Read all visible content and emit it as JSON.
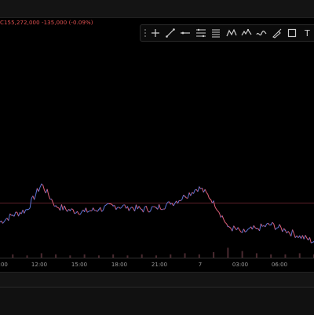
{
  "legend": {
    "symbol": "C",
    "last": "155,272,000",
    "change": "-135,000 (-0.09%)"
  },
  "toolbar": {
    "tools": [
      {
        "name": "crosshair-icon"
      },
      {
        "name": "trend-line-icon"
      },
      {
        "name": "horizontal-ray-icon"
      },
      {
        "name": "parallel-channel-icon"
      },
      {
        "name": "fib-retracement-icon"
      },
      {
        "name": "xabcd-pattern-icon"
      },
      {
        "name": "elliott-wave-icon"
      },
      {
        "name": "path-icon"
      },
      {
        "name": "brush-icon"
      },
      {
        "name": "rectangle-icon"
      },
      {
        "name": "text-icon",
        "glyph": "T"
      }
    ]
  },
  "colors": {
    "price_up": "#5b73d6",
    "price_down": "#e0607a",
    "ref_line": "#7a2a38",
    "volume": "#4a2a30"
  },
  "chart_data": {
    "type": "line",
    "x_ticks": [
      "9:00",
      "12:00",
      "15:00",
      "18:00",
      "21:00",
      "7",
      "03:00",
      "06:00"
    ],
    "x": [
      "9:00",
      "10:00",
      "11:00",
      "12:00",
      "13:00",
      "14:00",
      "15:00",
      "16:00",
      "17:00",
      "18:00",
      "19:00",
      "20:00",
      "21:00",
      "22:00",
      "23:00",
      "7",
      "01:00",
      "02:00",
      "03:00",
      "04:00",
      "05:00",
      "06:00",
      "07:00"
    ],
    "series": [
      {
        "values": [
          0.22,
          0.3,
          0.36,
          0.63,
          0.4,
          0.35,
          0.34,
          0.36,
          0.4,
          0.39,
          0.36,
          0.38,
          0.42,
          0.5,
          0.6,
          0.45,
          0.18,
          0.12,
          0.16,
          0.2,
          0.14,
          0.08,
          0.02
        ]
      }
    ],
    "reference_level": 0.43,
    "volume": [
      0.2,
      0.3,
      0.2,
      0.4,
      0.3,
      0.2,
      0.3,
      0.2,
      0.3,
      0.2,
      0.3,
      0.2,
      0.3,
      0.4,
      0.3,
      0.5,
      0.9,
      0.6,
      0.4,
      0.3,
      0.3,
      0.4,
      0.3
    ]
  }
}
